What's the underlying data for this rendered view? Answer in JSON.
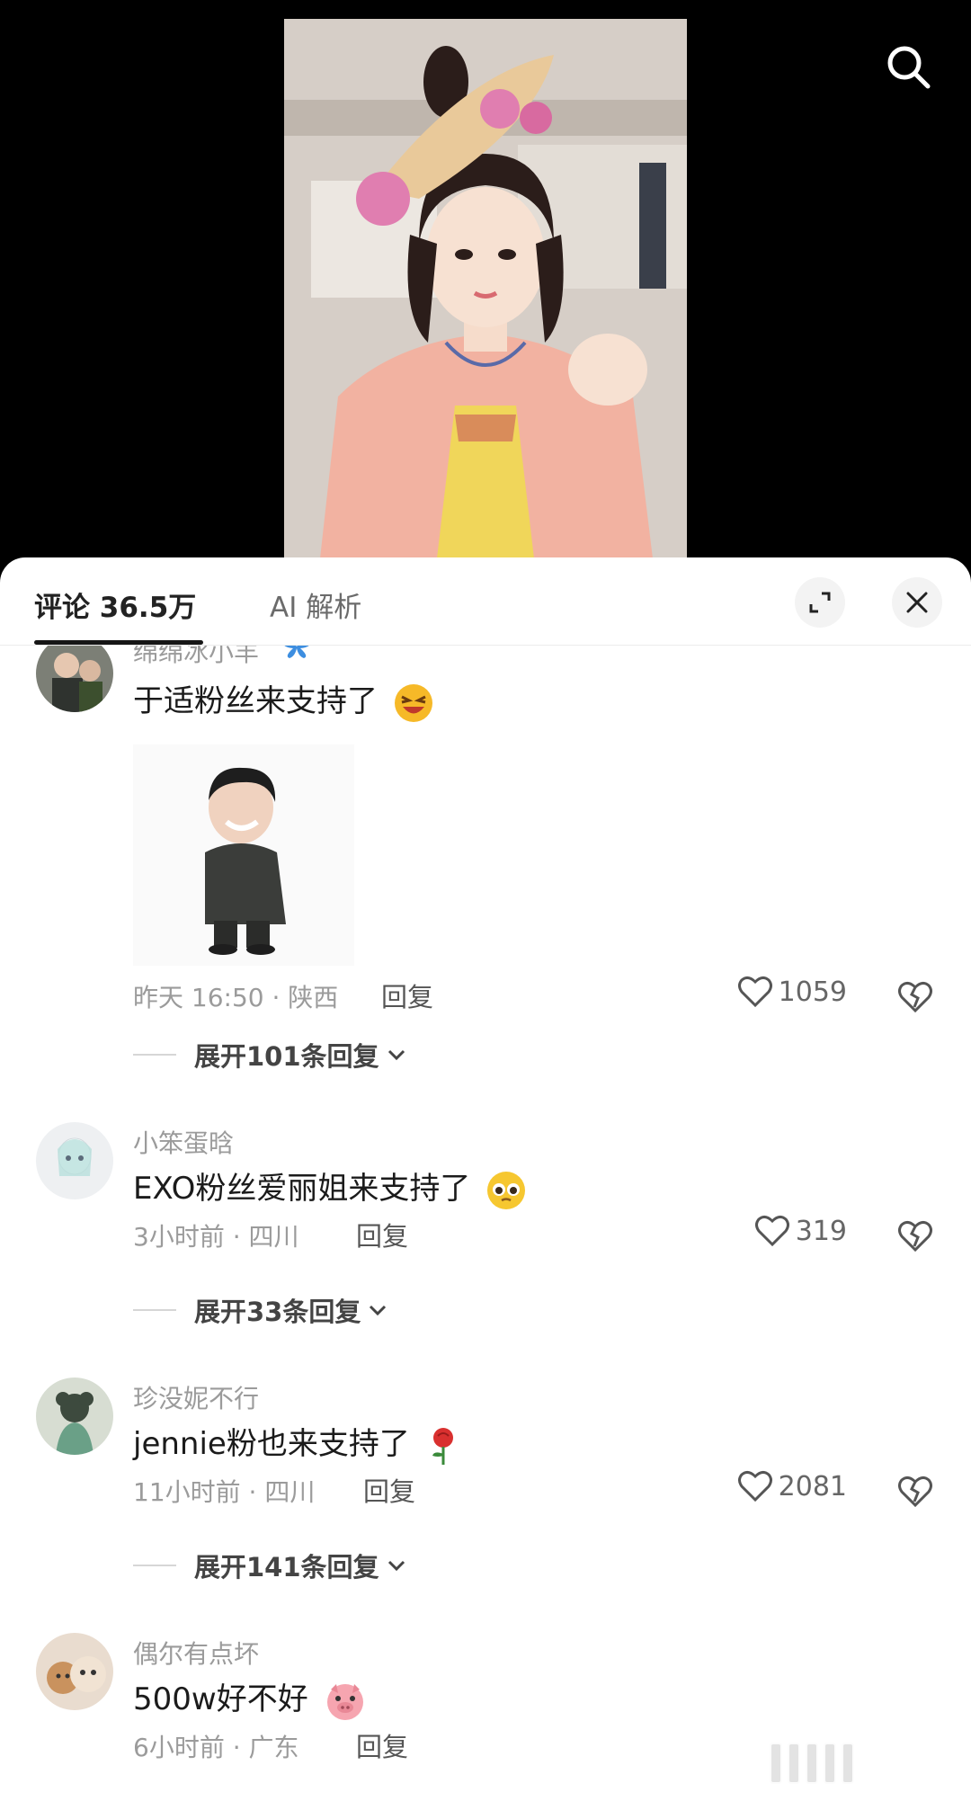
{
  "header": {
    "tab_comments": "评论 36.5万",
    "tab_ai": "AI 解析"
  },
  "icons": {
    "search": "search-icon",
    "expand": "expand-icon",
    "close": "close-icon",
    "like": "heart-icon",
    "dislike": "broken-heart-icon"
  },
  "comments": [
    {
      "user": "绵绵冰小羊",
      "text": "于适粉丝来支持了",
      "time_location": "昨天 16:50 · 陕西",
      "reply": "回复",
      "likes": "1059",
      "expand": "展开101条回复",
      "has_sticker": true
    },
    {
      "user": "小笨蛋晗",
      "text": "EXO粉丝爱丽姐来支持了",
      "time_location": "3小时前 · 四川",
      "reply": "回复",
      "likes": "319",
      "expand": "展开33条回复"
    },
    {
      "user": "珍没妮不行",
      "text": "jennie粉也来支持了",
      "time_location": "11小时前 · 四川",
      "reply": "回复",
      "likes": "2081",
      "expand": "展开141条回复"
    },
    {
      "user": "偶尔有点坏",
      "text": "500w好不好",
      "time_location": "6小时前 · 广东",
      "reply": "回复"
    }
  ],
  "colors": {
    "accent": "#161616",
    "muted": "#9b9b9b",
    "video_bg": "#000000"
  }
}
